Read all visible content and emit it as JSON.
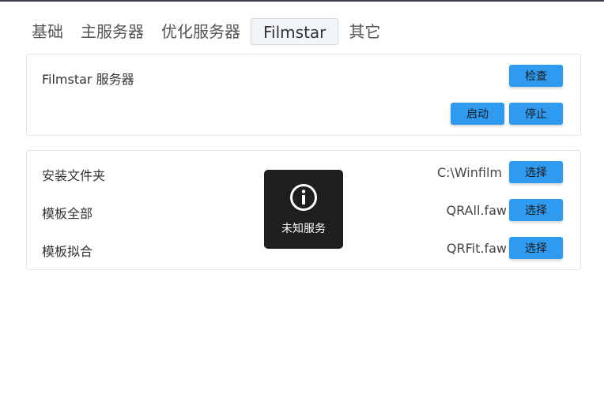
{
  "tabs": [
    {
      "label": "基础"
    },
    {
      "label": "主服务器"
    },
    {
      "label": "优化服务器"
    },
    {
      "label": "Filmstar",
      "active": true
    },
    {
      "label": "其它"
    }
  ],
  "server": {
    "title": "Filmstar 服务器",
    "check_label": "检查",
    "start_label": "启动",
    "stop_label": "停止"
  },
  "settings": {
    "rows": [
      {
        "label": "安装文件夹",
        "value": "C:\\Winfilm",
        "button": "选择"
      },
      {
        "label": "模板全部",
        "value": "QRAll.faw",
        "button": "选择"
      },
      {
        "label": "模板拟合",
        "value": "QRFit.faw",
        "button": "选择"
      }
    ]
  },
  "toast": {
    "icon": "info-icon",
    "message": "未知服务"
  },
  "colors": {
    "accent": "#2e9bf0",
    "toast_bg": "#1e1e1e",
    "border": "#e1e4e8"
  }
}
